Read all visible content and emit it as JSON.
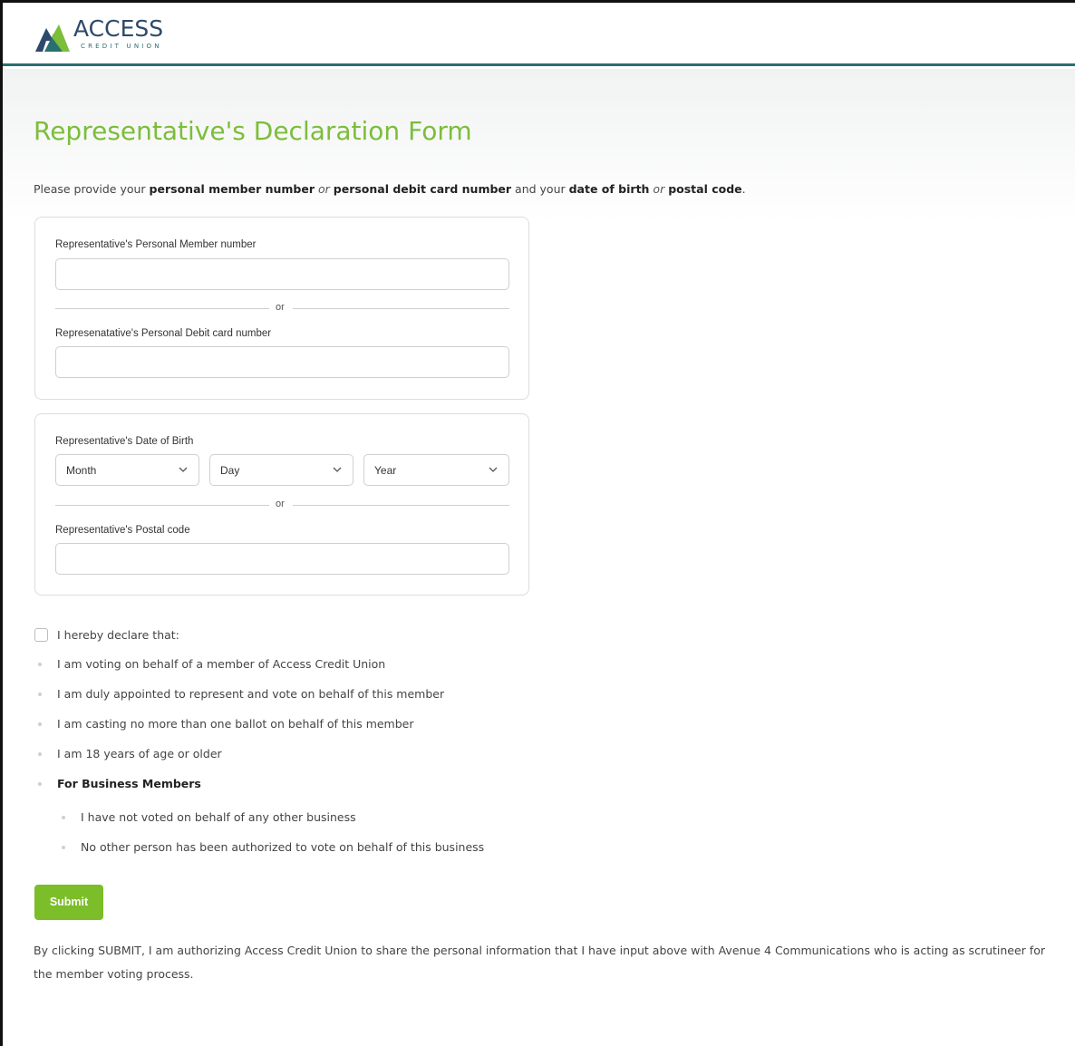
{
  "brand": {
    "logo_word": "ACCESS",
    "logo_sub": "CREDIT UNION",
    "accent": "#7cbd3a",
    "header_rule": "#2a6f6f"
  },
  "page": {
    "title": "Representative's Declaration Form"
  },
  "intro": {
    "p1": "Please provide your ",
    "b1": "personal member number",
    "or1": " or ",
    "b2": "personal debit card number",
    "p2": " and your ",
    "b3": "date of birth",
    "or2": " or ",
    "b4": "postal code",
    "p3": "."
  },
  "card1": {
    "member_label": "Representative's Personal Member number",
    "member_value": "",
    "or": "or",
    "debit_label": "Represenatative's Personal Debit card number",
    "debit_value": ""
  },
  "card2": {
    "dob_label": "Representative's Date of Birth",
    "month": "Month",
    "day": "Day",
    "year": "Year",
    "or": "or",
    "postal_label": "Representative's Postal code",
    "postal_value": ""
  },
  "declaration": {
    "label": "I hereby declare that:",
    "checked": false,
    "items": [
      "I am voting on behalf of a member of Access Credit Union",
      "I am duly appointed to represent and vote on behalf of this member",
      "I am casting no more than one ballot on behalf of this member",
      "I am 18 years of age or older"
    ],
    "business_heading": "For Business Members",
    "business_items": [
      "I have not voted on behalf of any other business",
      "No other person has been authorized to vote on behalf of this business"
    ]
  },
  "submit_label": "Submit",
  "consent": "By clicking SUBMIT, I am authorizing Access Credit Union to share the personal information that I have input above with Avenue 4 Communications who is acting as scrutineer for the member voting process."
}
